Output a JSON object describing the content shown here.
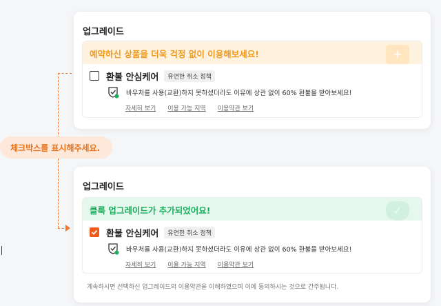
{
  "colors": {
    "orange_accent": "#f29a1c",
    "green_accent": "#1aae5c",
    "checkbox_checked": "#f05a1a",
    "annotation": "#e8741e"
  },
  "annotation": {
    "pill_text": "체크박스를 표시해주세요."
  },
  "card_unchecked": {
    "title": "업그레이드",
    "banner_text": "예약하신 상품을 더욱 걱정 없이 이용해보세요!",
    "banner_icon": "plus-icon",
    "checkbox_checked": false,
    "product_name": "환불 안심케어",
    "tag": "유연한 취소 정책",
    "description": "바우처를 사용(교환)하지 못하셨더라도 이유에 상관 없이 60% 환불을 받아보세요!",
    "links": [
      "자세히 보기",
      "이용 가능 지역",
      "이용약관 보기"
    ]
  },
  "card_checked": {
    "title": "업그레이드",
    "banner_text": "클룩 업그레이드가 추가되었어요!",
    "banner_icon": "shield-check-icon",
    "checkbox_checked": true,
    "product_name": "환불 안심케어",
    "tag": "유연한 취소 정책",
    "description": "바우처를 사용(교환)하지 못하셨더라도 이유에 상관 없이 60% 환불을 받아보세요!",
    "links": [
      "자세히 보기",
      "이용 가능 지역",
      "이용약관 보기"
    ],
    "footnote": "계속하시면 선택하신 업그레이드의 이용약관을 이해하였으며 이에 동의하시는 것으로 간주됩니다."
  }
}
